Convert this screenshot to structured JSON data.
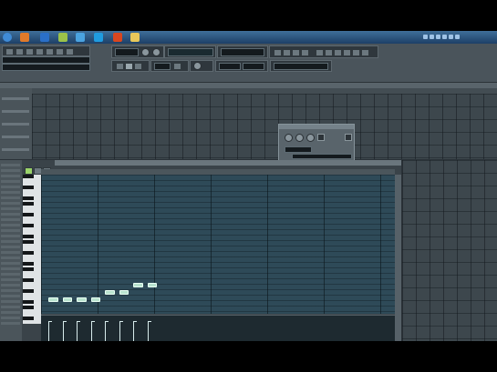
{
  "taskbar": {
    "clock_time": "",
    "clock_date": "",
    "pinned_apps": [
      "start-orb-icon",
      "firefox-icon",
      "explorer-icon",
      "media-icon",
      "chrome-icon",
      "skype-icon",
      "office-icon",
      "folder-icon"
    ]
  },
  "piano_roll": {
    "title": "",
    "notes": [
      {
        "start": 0,
        "length": 1,
        "pitch": 0
      },
      {
        "start": 1,
        "length": 1,
        "pitch": 0
      },
      {
        "start": 2,
        "length": 1,
        "pitch": 0
      },
      {
        "start": 3,
        "length": 1,
        "pitch": 0
      },
      {
        "start": 4,
        "length": 1,
        "pitch": 2
      },
      {
        "start": 5,
        "length": 1,
        "pitch": 2
      },
      {
        "start": 6,
        "length": 1,
        "pitch": 4
      },
      {
        "start": 7,
        "length": 1,
        "pitch": 4
      }
    ],
    "velocities": [
      0.85,
      0.85,
      0.85,
      0.85,
      0.85,
      0.85,
      0.85,
      0.85
    ]
  },
  "colors": {
    "note_fill": "#b9e3cf",
    "grid_bg": "#2e4a58",
    "taskbar": "#2a5582"
  }
}
